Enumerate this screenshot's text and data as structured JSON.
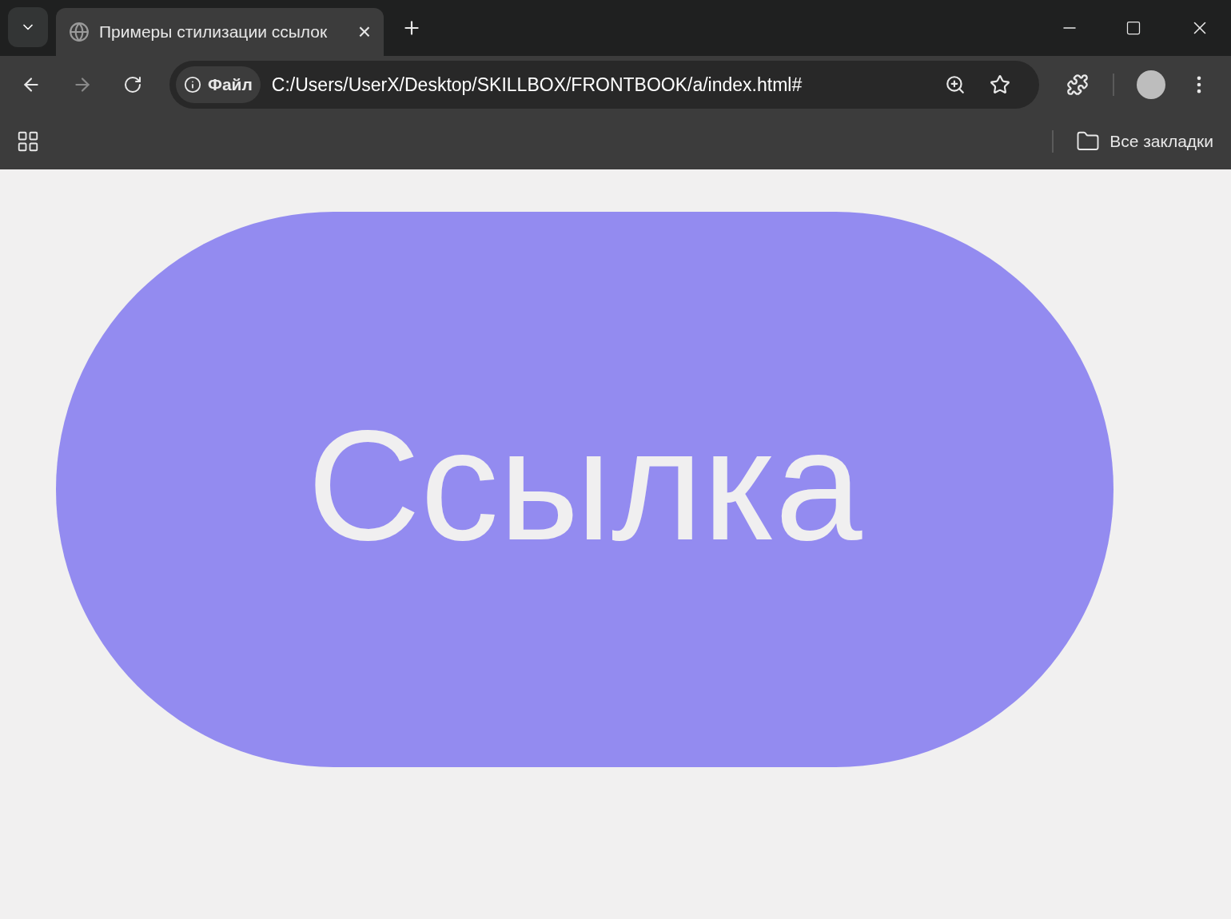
{
  "tabs": [
    {
      "title": "Примеры стилизации ссылок",
      "selected": true,
      "close": "×"
    }
  ],
  "address_bar": {
    "security_label": "Файл",
    "url": "C:/Users/UserX/Desktop/SKILLBOX/FRONTBOOK/a/index.html#"
  },
  "bookmarks_bar": {
    "all_bookmarks": "Все закладки"
  },
  "page": {
    "link_button": "Ссылка"
  }
}
